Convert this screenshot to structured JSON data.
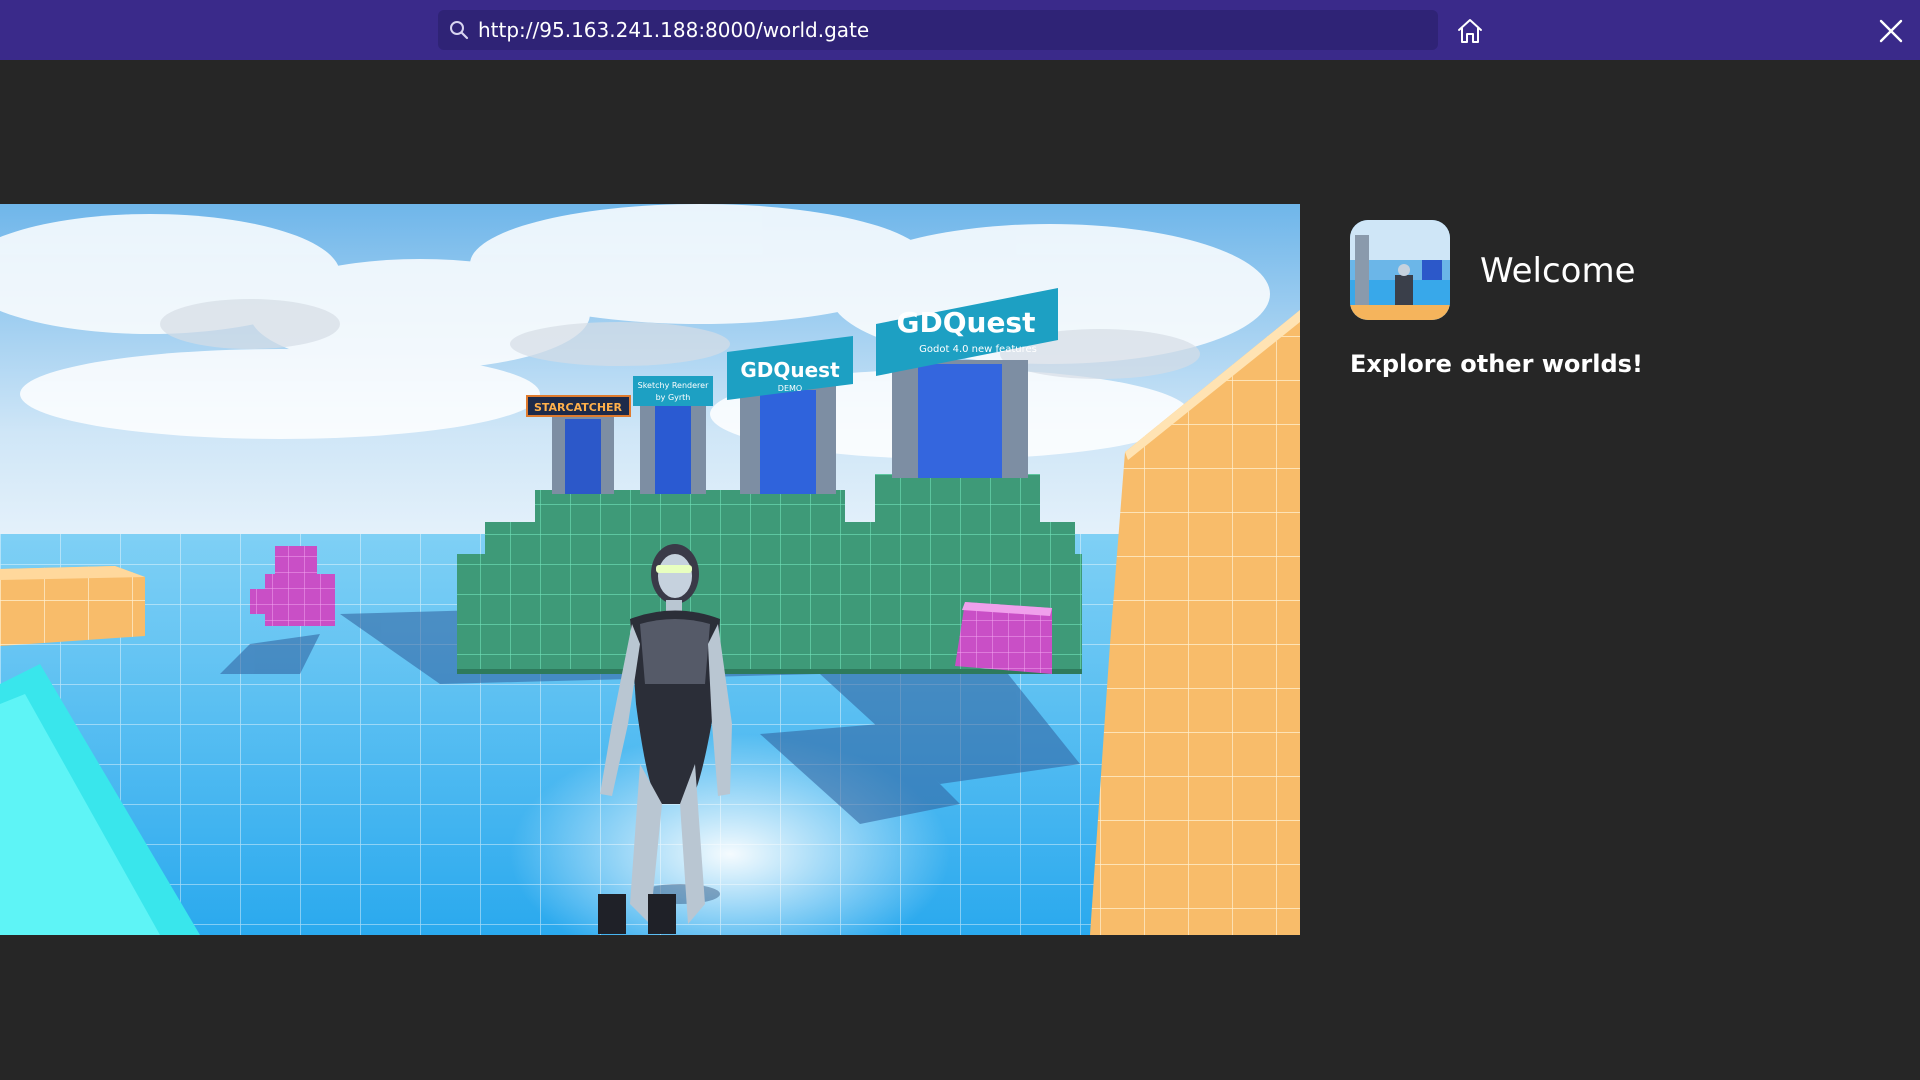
{
  "browser": {
    "url": "http://95.163.241.188:8000/world.gate",
    "icons": {
      "search": "search-icon",
      "home": "home-icon",
      "close": "close-icon"
    },
    "colors": {
      "topbar": "#3a2a8a",
      "urlbar": "#2f2376",
      "background": "#262626"
    }
  },
  "scene": {
    "signs": [
      "STARCATCHER",
      "Sketchy Renderer by Gyrth",
      "GDQuest DEMO",
      "GDQuest Godot 4.0 new features"
    ]
  },
  "panel": {
    "title": "Welcome",
    "subtitle": "Explore other worlds!"
  }
}
